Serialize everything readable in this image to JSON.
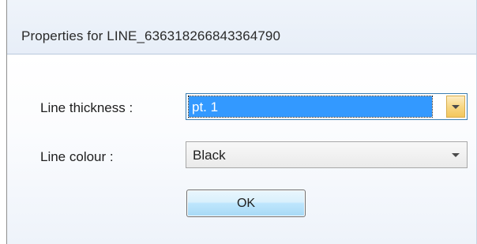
{
  "window": {
    "title": "Properties for LINE_636318266843364790"
  },
  "form": {
    "thickness_label": "Line thickness :",
    "thickness_value": "pt. 1",
    "colour_label": "Line colour :",
    "colour_value": "Black",
    "ok_label": "OK"
  },
  "colors": {
    "selection": "#3399ff",
    "dropdown_hover": "#f7d886"
  },
  "icons": {
    "dropdown": "chevron-down-icon"
  }
}
